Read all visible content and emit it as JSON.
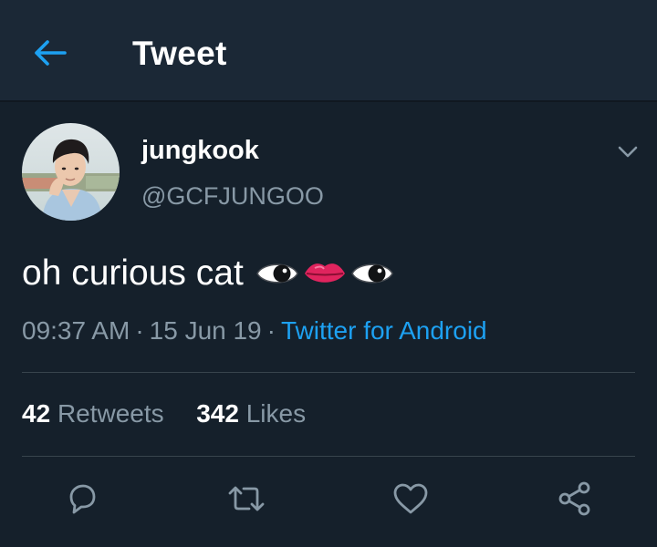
{
  "header": {
    "title": "Tweet",
    "back_icon": "arrow-left-icon",
    "accent_color": "#1da1f2",
    "background_color": "#1b2836"
  },
  "tweet": {
    "author": {
      "display_name": "jungkook",
      "handle": "@GCFJUNGOO",
      "avatar_icon": "avatar"
    },
    "text": "oh curious cat",
    "emojis": [
      "eye-emoji",
      "lips-emoji",
      "eye-emoji"
    ],
    "time": "09:37 AM",
    "date": "15 Jun 19",
    "separator": "·",
    "source": "Twitter for Android",
    "stats": {
      "retweets_count": "42",
      "retweets_label": "Retweets",
      "likes_count": "342",
      "likes_label": "Likes"
    },
    "actions": [
      "reply-icon",
      "retweet-icon",
      "like-icon",
      "share-icon"
    ]
  },
  "colors": {
    "page_background": "#15202b",
    "secondary_text": "#8899a6",
    "link": "#1da1f2",
    "divider": "#38444d"
  }
}
